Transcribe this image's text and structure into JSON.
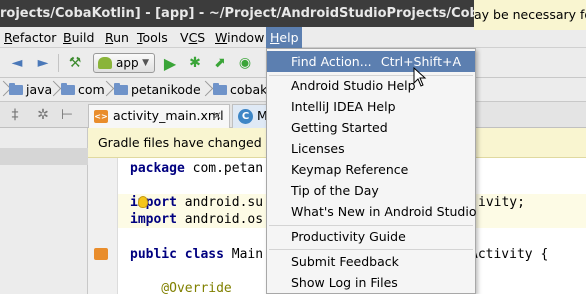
{
  "window": {
    "title": "rojects/CobaKotlin] - [app] - ~/Project/AndroidStudioProjects/CobaKotlin/app/src/main/java"
  },
  "menubar": {
    "items": [
      {
        "label": "Refactor",
        "mnemonic_index": 0
      },
      {
        "label": "Build",
        "mnemonic_index": 0
      },
      {
        "label": "Run",
        "mnemonic_index": 0
      },
      {
        "label": "Tools",
        "mnemonic_index": 0
      },
      {
        "label": "VCS",
        "mnemonic_index": 1
      },
      {
        "label": "Window",
        "mnemonic_index": 0
      },
      {
        "label": "Help",
        "mnemonic_index": 0
      }
    ],
    "active": "Help"
  },
  "toolbar": {
    "run_config": "app"
  },
  "navbar": {
    "crumbs": [
      "java",
      "com",
      "petanikode",
      "cobako"
    ]
  },
  "tabs": {
    "activity": "activity_main.xml",
    "main": "M"
  },
  "notification": {
    "text": "Gradle files have changed sinc",
    "right_text": "ay be necessary for th"
  },
  "editor": {
    "lines": [
      {
        "parts": [
          {
            "t": "package ",
            "c": "kw"
          },
          {
            "t": "com.petan",
            "c": ""
          }
        ]
      },
      {
        "parts": [
          {
            "t": "import ",
            "c": "kw"
          },
          {
            "t": "android.su",
            "c": ""
          }
        ],
        "tail": "ivity;"
      },
      {
        "parts": [
          {
            "t": "import ",
            "c": "kw"
          },
          {
            "t": "android.os",
            "c": ""
          }
        ]
      },
      {
        "parts": [
          {
            "t": "public class ",
            "c": "kw"
          },
          {
            "t": "Main",
            "c": ""
          }
        ],
        "tail": "Activity {"
      },
      {
        "parts": [
          {
            "t": "    @Override",
            "c": "ann"
          }
        ]
      }
    ]
  },
  "help_menu": {
    "items": [
      {
        "label": "Find Action...",
        "shortcut": "Ctrl+Shift+A",
        "selected": true
      },
      {
        "label": "Android Studio Help"
      },
      {
        "label": "IntelliJ IDEA Help"
      },
      {
        "label": "Getting Started"
      },
      {
        "label": "Licenses"
      },
      {
        "label": "Keymap Reference"
      },
      {
        "label": "Tip of the Day"
      },
      {
        "label": "What's New in Android Studio"
      },
      {
        "label": "Productivity Guide"
      },
      {
        "label": "Submit Feedback"
      },
      {
        "label": "Show Log in Files"
      }
    ]
  },
  "colors": {
    "selection": "#5c7fb0",
    "titlebar": "#3c3c3c",
    "notification": "#f9f5d0",
    "keyword": "#000080"
  }
}
